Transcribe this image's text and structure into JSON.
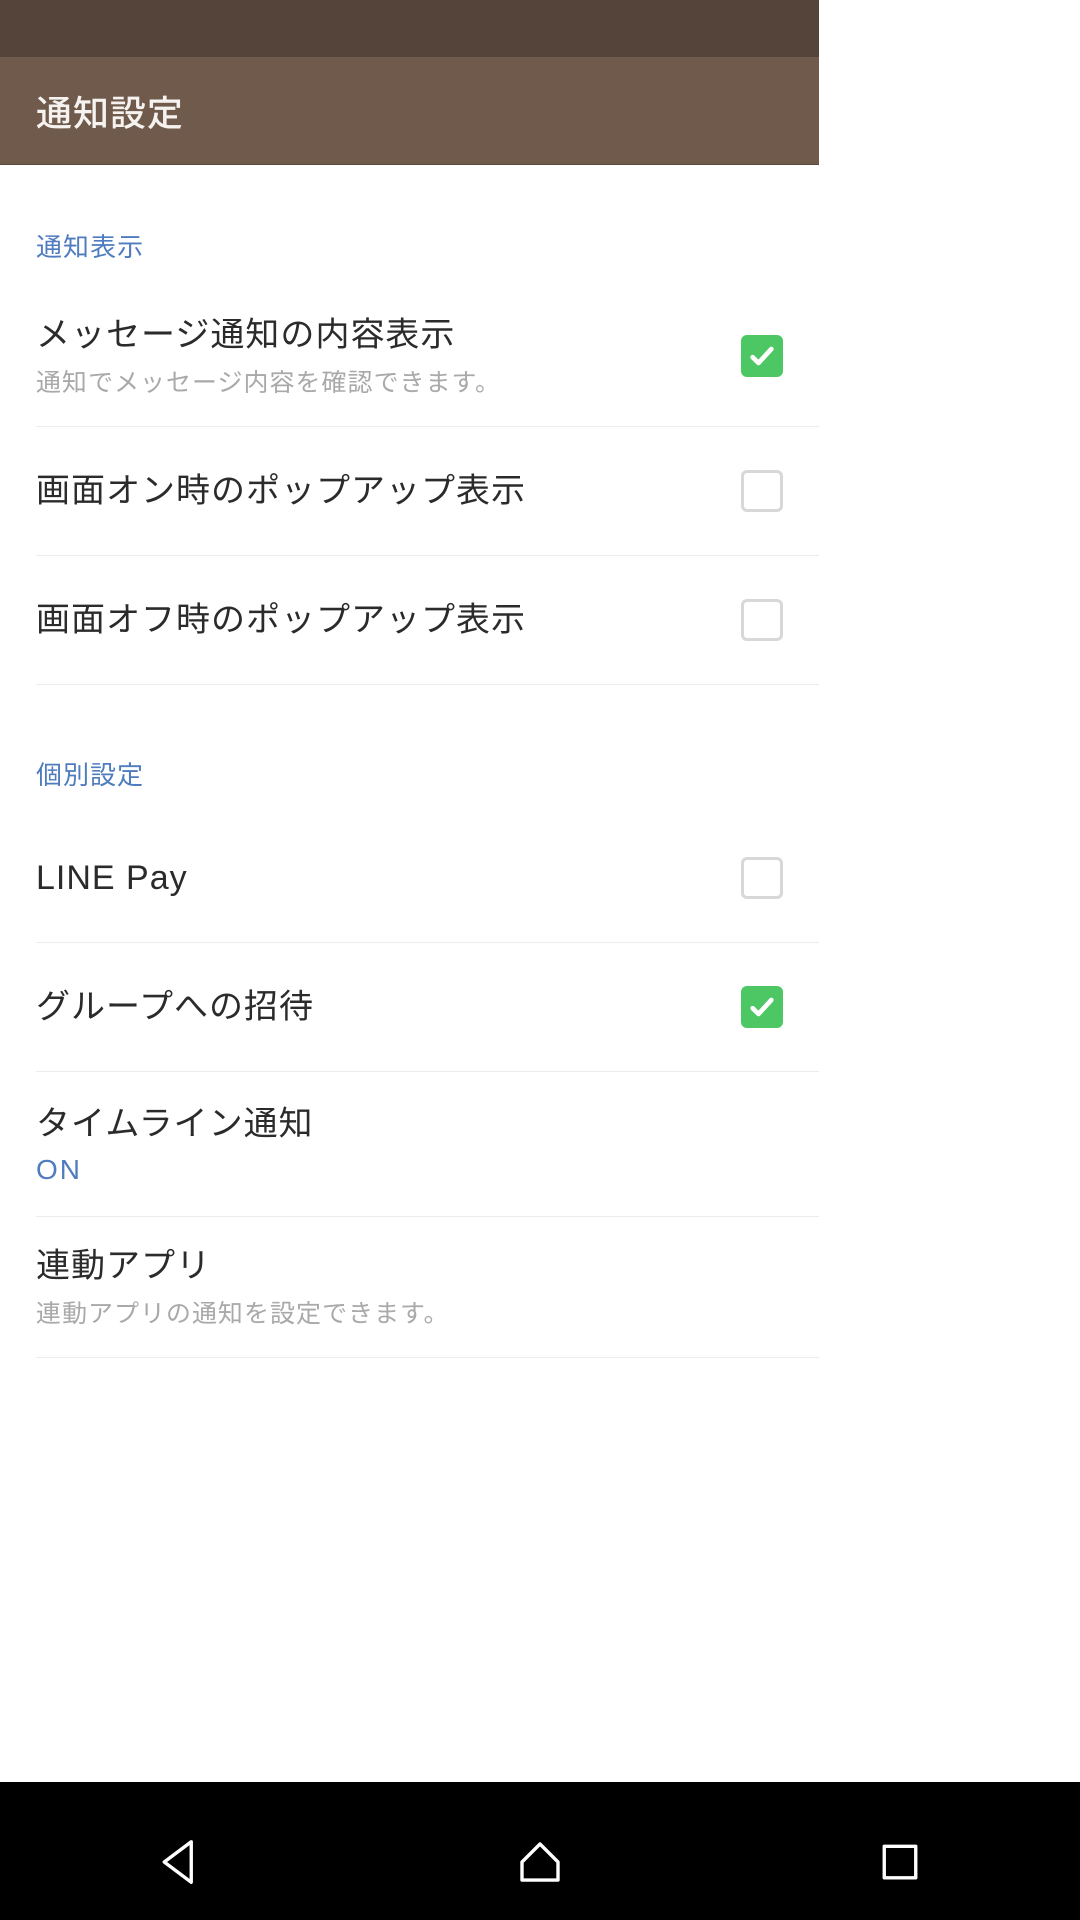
{
  "header": {
    "title": "通知設定"
  },
  "sections": {
    "display": {
      "label": "通知表示",
      "items": [
        {
          "title": "メッセージ通知の内容表示",
          "sub": "通知でメッセージ内容を確認できます。",
          "checked": true
        },
        {
          "title": "画面オン時のポップアップ表示",
          "checked": false
        },
        {
          "title": "画面オフ時のポップアップ表示",
          "checked": false
        }
      ]
    },
    "individual": {
      "label": "個別設定",
      "items": [
        {
          "title": "LINE Pay",
          "checked": false
        },
        {
          "title": "グループへの招待",
          "checked": true
        },
        {
          "title": "タイムライン通知",
          "value": "ON"
        },
        {
          "title": "連動アプリ",
          "sub": "連動アプリの通知を設定できます。"
        }
      ]
    }
  }
}
